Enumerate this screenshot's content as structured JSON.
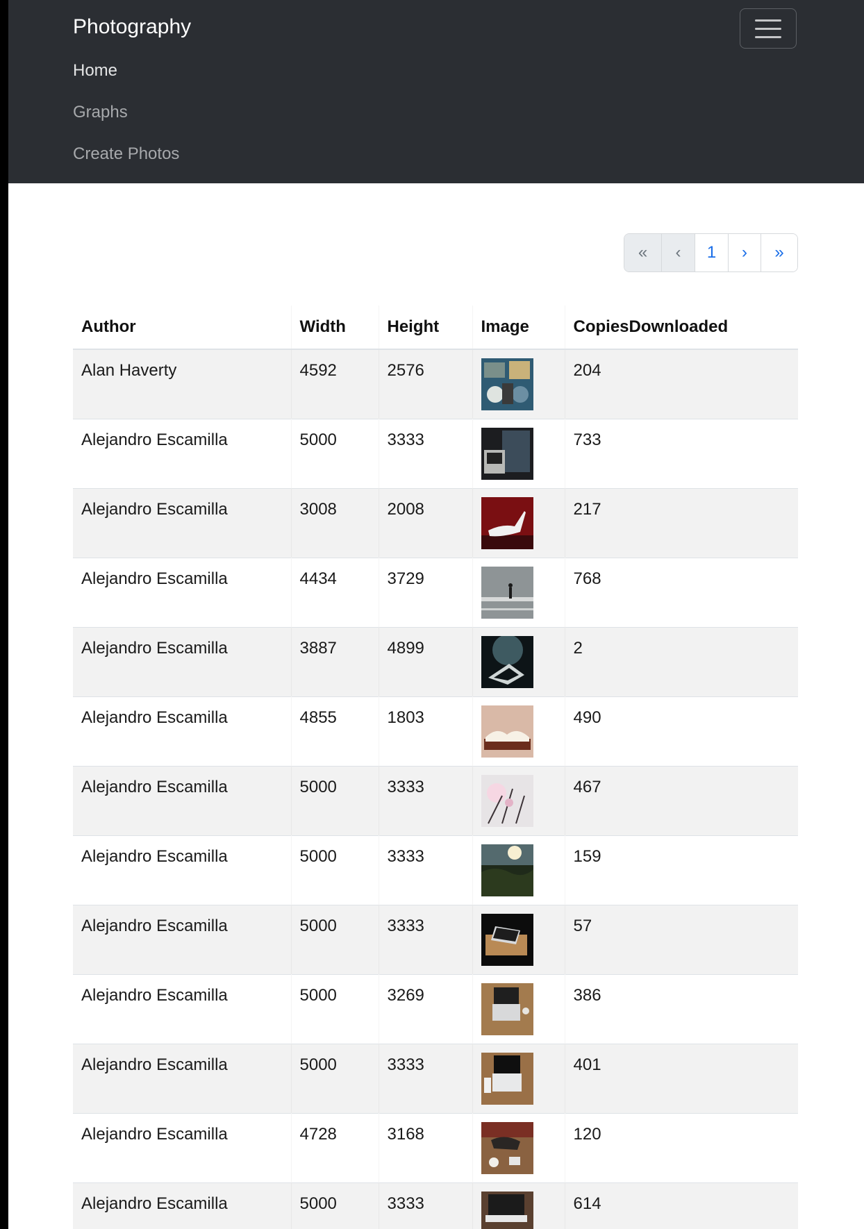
{
  "navbar": {
    "brand": "Photography",
    "links": [
      {
        "label": "Home"
      },
      {
        "label": "Graphs"
      },
      {
        "label": "Create Photos"
      }
    ]
  },
  "pagination": {
    "first": "«",
    "prev": "‹",
    "current": "1",
    "next": "›",
    "last": "»"
  },
  "table": {
    "headers": [
      "Author",
      "Width",
      "Height",
      "Image",
      "CopiesDownloaded"
    ],
    "rows": [
      {
        "author": "Alan Haverty",
        "width": "4592",
        "height": "2576",
        "copies": "204",
        "thumb": "map-desk"
      },
      {
        "author": "Alejandro Escamilla",
        "width": "5000",
        "height": "3333",
        "copies": "733",
        "thumb": "person-laptop"
      },
      {
        "author": "Alejandro Escamilla",
        "width": "3008",
        "height": "2008",
        "copies": "217",
        "thumb": "white-heels"
      },
      {
        "author": "Alejandro Escamilla",
        "width": "4434",
        "height": "3729",
        "copies": "768",
        "thumb": "street-walker"
      },
      {
        "author": "Alejandro Escamilla",
        "width": "3887",
        "height": "4899",
        "copies": "2",
        "thumb": "dark-piano"
      },
      {
        "author": "Alejandro Escamilla",
        "width": "4855",
        "height": "1803",
        "copies": "490",
        "thumb": "open-book"
      },
      {
        "author": "Alejandro Escamilla",
        "width": "5000",
        "height": "3333",
        "copies": "467",
        "thumb": "blossom-branches"
      },
      {
        "author": "Alejandro Escamilla",
        "width": "5000",
        "height": "3333",
        "copies": "159",
        "thumb": "sunset-field"
      },
      {
        "author": "Alejandro Escamilla",
        "width": "5000",
        "height": "3333",
        "copies": "57",
        "thumb": "laptop-dark"
      },
      {
        "author": "Alejandro Escamilla",
        "width": "5000",
        "height": "3269",
        "copies": "386",
        "thumb": "laptop-wood"
      },
      {
        "author": "Alejandro Escamilla",
        "width": "5000",
        "height": "3333",
        "copies": "401",
        "thumb": "laptop-white"
      },
      {
        "author": "Alejandro Escamilla",
        "width": "4728",
        "height": "3168",
        "copies": "120",
        "thumb": "coffee-desk"
      },
      {
        "author": "Alejandro Escamilla",
        "width": "5000",
        "height": "3333",
        "copies": "614",
        "thumb": "laptop-cafe"
      }
    ]
  },
  "colors": {
    "navbar_bg": "#2b2e33",
    "link_primary": "#1a6ee8",
    "row_stripe": "#f2f2f2"
  }
}
